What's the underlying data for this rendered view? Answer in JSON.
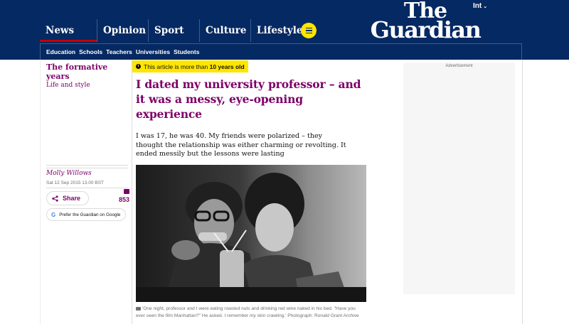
{
  "header": {
    "edition": "Int",
    "logo_line1": "The",
    "logo_line2": "Guardian",
    "pillars": [
      "News",
      "Opinion",
      "Sport",
      "Culture",
      "Lifestyle"
    ],
    "subnav": [
      "Education",
      "Schools",
      "Teachers",
      "Universities",
      "Students"
    ],
    "colors": {
      "brand": "#052962",
      "accent": "#ffe500",
      "active_pillar": "#c70000"
    }
  },
  "left": {
    "series_title": "The formative years",
    "section": "Life and style",
    "author": "Molly Willows",
    "date": "Sat 12 Sep 2015 13.00 BST",
    "share_label": "Share",
    "comment_count": "853",
    "prefer_label": "Prefer the Guardian on Google"
  },
  "article": {
    "age_notice_prefix": "This article is more than ",
    "age_notice_bold": "10 years old",
    "headline": "I dated my university professor – and it was a messy, eye-opening experience",
    "standfirst": "I was 17, he was 40. My friends were polarized – they thought the relationship was either charming or revolting. It ended messily but the lessons were lasting",
    "caption": "'One night, professor and I were eating roasted nuts and drinking red wine naked in his bed. \"Have you ever seen the film Manhattan?\" He asked. I remember my skin crawling.' Photograph: Ronald Grant Archive",
    "theme_color": "#7d0068"
  },
  "ad": {
    "label": "Advertisement"
  }
}
